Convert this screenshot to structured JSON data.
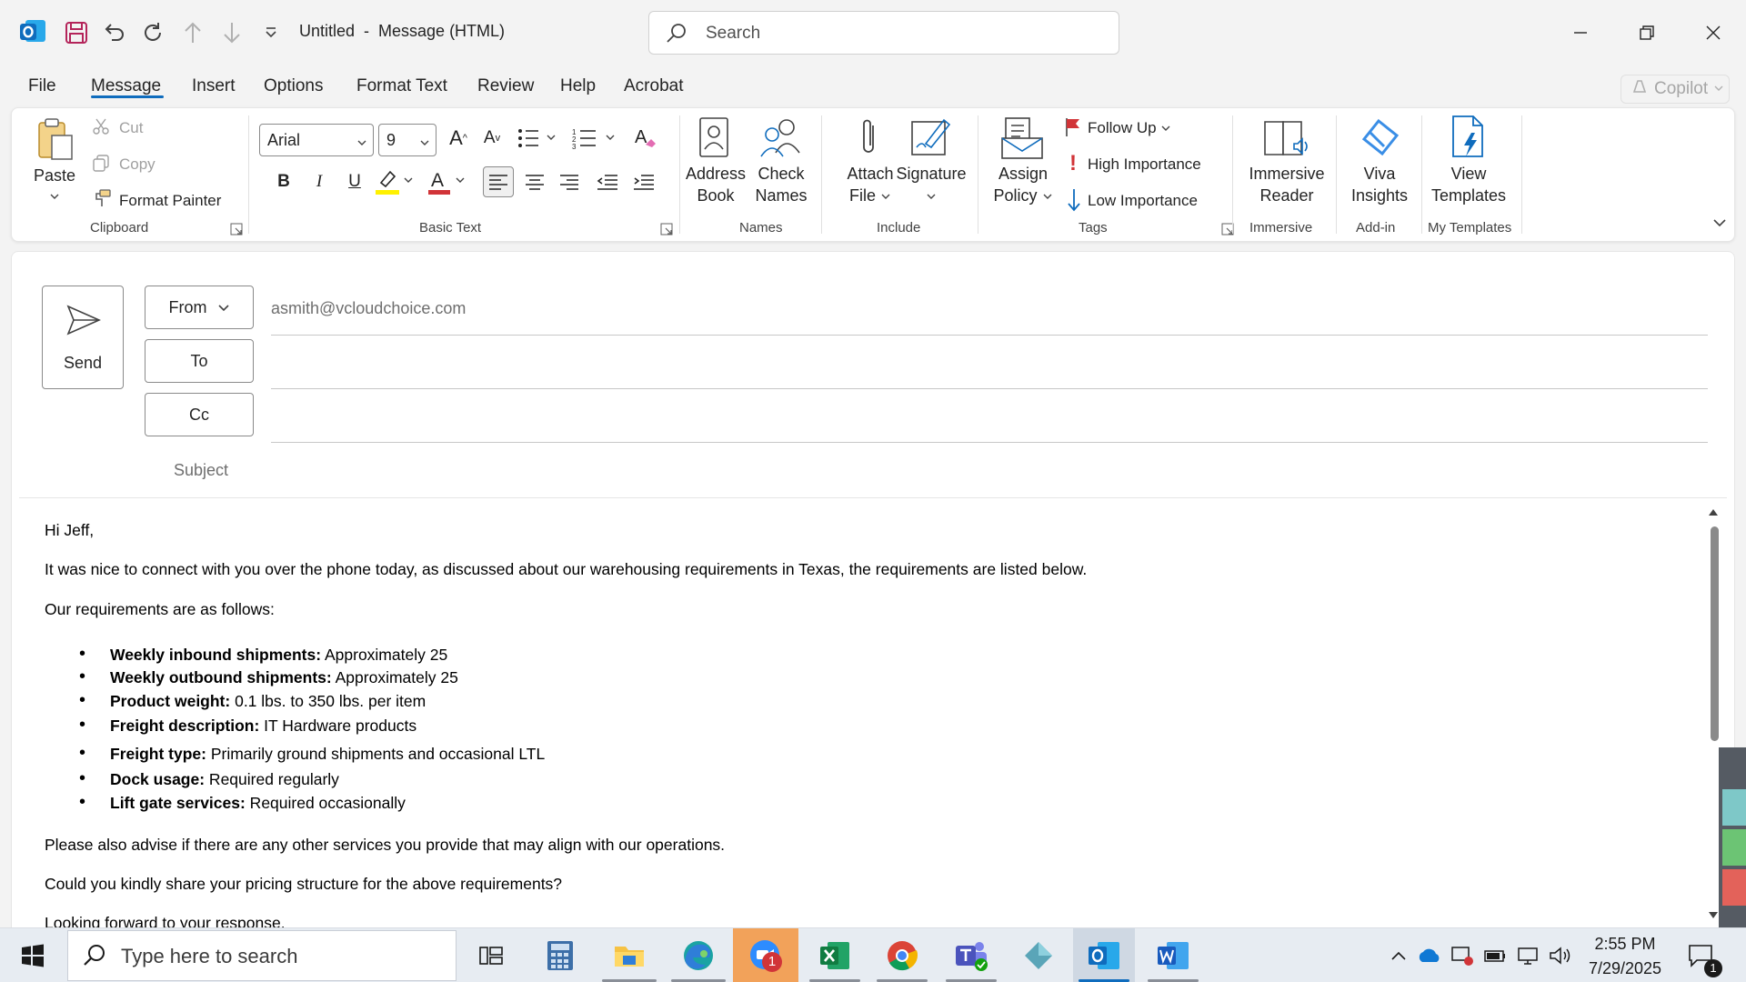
{
  "titlebar": {
    "doc_title": "Untitled  -  Message (HTML)",
    "search_placeholder": "Search"
  },
  "menu": {
    "tabs": [
      {
        "label": "File"
      },
      {
        "label": "Message"
      },
      {
        "label": "Insert"
      },
      {
        "label": "Options"
      },
      {
        "label": "Format Text"
      },
      {
        "label": "Review"
      },
      {
        "label": "Help"
      },
      {
        "label": "Acrobat"
      }
    ],
    "active_tab": "Message",
    "copilot_label": "Copilot"
  },
  "ribbon": {
    "clipboard": {
      "paste": "Paste",
      "cut": "Cut",
      "copy": "Copy",
      "format_painter": "Format Painter",
      "group_label": "Clipboard"
    },
    "basic_text": {
      "font_name": "Arial",
      "font_size": "9",
      "bold": "B",
      "italic": "I",
      "underline": "U",
      "grow": "A",
      "shrink": "A",
      "font_color_glyph": "A",
      "group_label": "Basic Text"
    },
    "names": {
      "address_book_1": "Address",
      "address_book_2": "Book",
      "check_names_1": "Check",
      "check_names_2": "Names",
      "group_label": "Names"
    },
    "include": {
      "attach_1": "Attach",
      "attach_2": "File",
      "signature": "Signature",
      "group_label": "Include"
    },
    "tags": {
      "assign_1": "Assign",
      "assign_2": "Policy",
      "follow_up": "Follow Up",
      "high_importance": "High Importance",
      "low_importance": "Low Importance",
      "group_label": "Tags"
    },
    "immersive": {
      "reader_1": "Immersive",
      "reader_2": "Reader",
      "group_label": "Immersive"
    },
    "addin": {
      "viva_1": "Viva",
      "viva_2": "Insights",
      "group_label": "Add-in"
    },
    "templates": {
      "view_1": "View",
      "view_2": "Templates",
      "group_label": "My Templates"
    }
  },
  "compose": {
    "send": "Send",
    "from": "From",
    "to": "To",
    "cc": "Cc",
    "subject_label": "Subject",
    "from_email": "asmith@vcloudchoice.com"
  },
  "body": {
    "greeting": "Hi Jeff,",
    "intro": "It was nice to connect with you over the phone today, as discussed about our warehousing requirements in Texas, the requirements are listed below.",
    "reqs_intro": "Our requirements are as follows:",
    "requirements": [
      {
        "label": "Weekly inbound shipments:",
        "value": " Approximately 25"
      },
      {
        "label": "Weekly outbound shipments:",
        "value": " Approximately 25"
      },
      {
        "label": "Product weight:",
        "value": " 0.1 lbs. to 350 lbs. per item"
      },
      {
        "label": "Freight description:",
        "value": " IT Hardware products"
      },
      {
        "label": "Freight type:",
        "value": " Primarily ground shipments and occasional LTL"
      },
      {
        "label": "Dock usage:",
        "value": " Required regularly"
      },
      {
        "label": "Lift gate services:",
        "value": " Required occasionally"
      }
    ],
    "advise": "Please also advise if there are any other services you provide that may align with our operations.",
    "pricing": "Could you kindly share your pricing structure for the above requirements?",
    "closing": "Looking forward to your response."
  },
  "taskbar": {
    "search_placeholder": "Type here to search",
    "time": "2:55 PM",
    "date": "7/29/2025",
    "zoom_badge": "1",
    "notification_count": "1"
  },
  "colors": {
    "accent": "#0f6cbd",
    "follow_up_flag": "#d13438",
    "high_importance": "#d13438",
    "low_importance": "#0f6cbd",
    "excel": "#107c41",
    "word": "#185abd",
    "outlook": "#0f6cbd"
  }
}
